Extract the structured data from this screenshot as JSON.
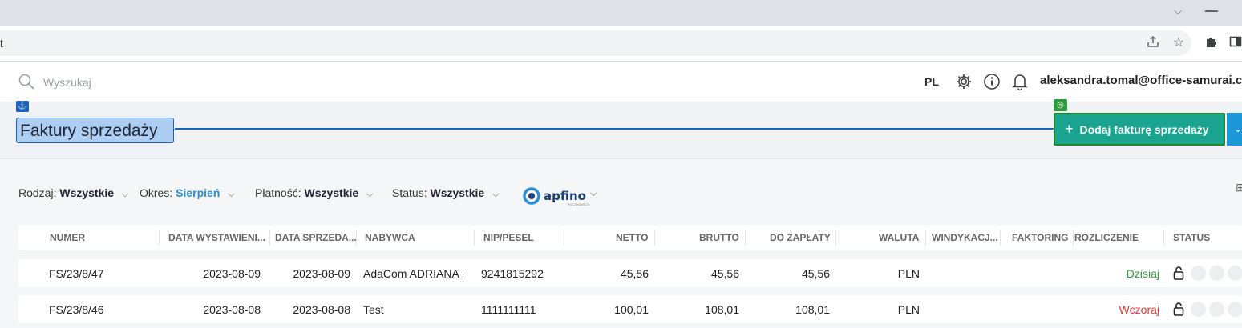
{
  "browser": {
    "url_fragment": "t"
  },
  "header": {
    "search_placeholder": "Wyszukaj",
    "language": "PL",
    "user_email": "aleksandra.tomal@office-samurai.c"
  },
  "page": {
    "title": "Faktury sprzedaży",
    "add_button_label": "Dodaj fakturę sprzedaży"
  },
  "filters": {
    "rodzaj_label": "Rodzaj:",
    "rodzaj_value": "Wszystkie",
    "okres_label": "Okres:",
    "okres_value": "Sierpień",
    "platnosc_label": "Płatność:",
    "platnosc_value": "Wszystkie",
    "status_label": "Status:",
    "status_value": "Wszystkie",
    "apfino_logo": "apfino",
    "apfino_sub": "by COMARCH"
  },
  "table": {
    "columns": [
      "NUMER",
      "DATA WYSTAWIENI...",
      "DATA SPRZEDA...",
      "NABYWCA",
      "NIP/PESEL",
      "NETTO",
      "BRUTTO",
      "DO ZAPŁATY",
      "WALUTA",
      "WINDYKACJ...",
      "FAKTORING",
      "ROZLICZENIE",
      "STATUS"
    ],
    "rows": [
      {
        "numer": "FS/23/8/47",
        "data_wyst": "2023-08-09",
        "data_sprz": "2023-08-09",
        "nabywca": "AdaCom ADRIANA MA",
        "nip": "9241815292",
        "netto": "45,56",
        "brutto": "45,56",
        "do_zaplaty": "45,56",
        "waluta": "PLN",
        "rozliczenie": "Dzisiaj"
      },
      {
        "numer": "FS/23/8/46",
        "data_wyst": "2023-08-08",
        "data_sprz": "2023-08-08",
        "nabywca": "Test",
        "nip": "1111111111",
        "netto": "100,01",
        "brutto": "108,01",
        "do_zaplaty": "108,01",
        "waluta": "PLN",
        "rozliczenie": "Wczoraj"
      }
    ]
  },
  "colors": {
    "accent_blue": "#2b8fd8",
    "add_button_teal": "#1aa38e",
    "rozliczenie_today": "#2e9b3a",
    "rozliczenie_overdue": "#e53935"
  }
}
